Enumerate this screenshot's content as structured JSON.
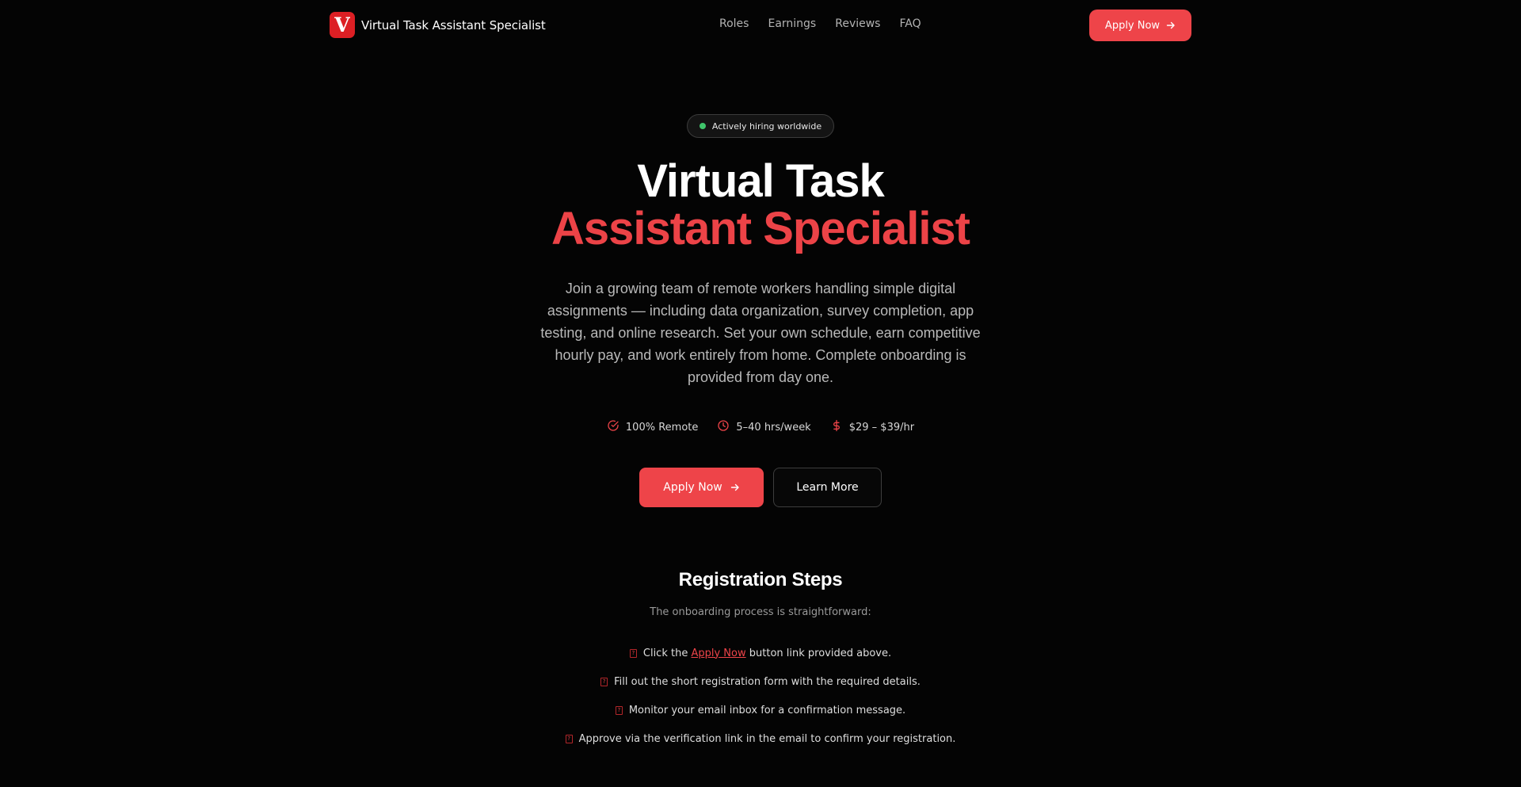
{
  "nav": {
    "brand_logo_letter": "V",
    "brand_name": "Virtual Task Assistant Specialist",
    "links": [
      "Roles",
      "Earnings",
      "Reviews",
      "FAQ"
    ],
    "cta_label": "Apply Now"
  },
  "hero": {
    "badge_text": "Actively hiring worldwide",
    "title_line1": "Virtual Task",
    "title_line2": "Assistant Specialist",
    "description": "Join a growing team of remote workers handling simple digital assignments — including data organization, survey completion, app testing, and online research. Set your own schedule, earn competitive hourly pay, and work entirely from home. Complete onboarding is provided from day one.",
    "features": [
      {
        "icon": "check-circle-icon",
        "label": "100% Remote"
      },
      {
        "icon": "clock-icon",
        "label": "5–40 hrs/week"
      },
      {
        "icon": "dollar-icon",
        "label": "$29 – $39/hr"
      }
    ],
    "primary_button": "Apply Now",
    "secondary_button": "Learn More"
  },
  "registration": {
    "title": "Registration Steps",
    "subtitle": "The onboarding process is straightforward:",
    "step_marker": "?",
    "step1_before": "Click the",
    "step1_link": "Apply Now",
    "step1_after": "button link provided above.",
    "step2": "Fill out the short registration form with the required details.",
    "step3": "Monitor your email inbox for a confirmation message.",
    "step4": "Approve via the verification link in the email to confirm your registration."
  },
  "colors": {
    "background": "#040404",
    "accent": "#ee4449",
    "logo_red": "#dc1f24",
    "hiring_dot": "#3fc56b",
    "muted_text": "#b9b9b9"
  }
}
